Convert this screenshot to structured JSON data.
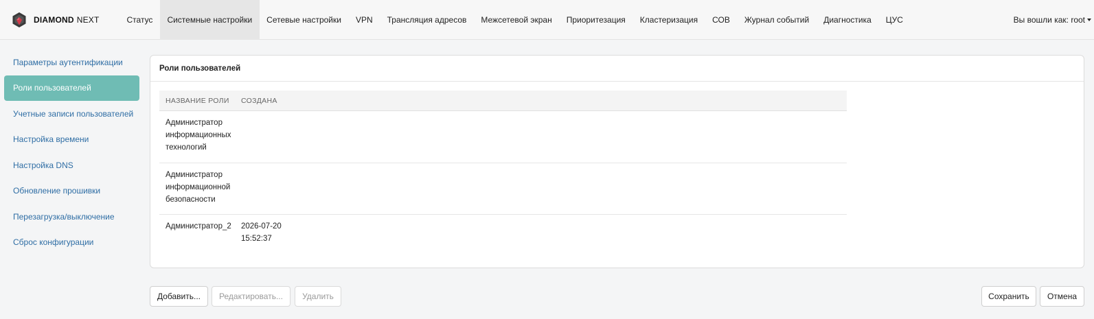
{
  "brand": {
    "name": "DIAMOND",
    "suffix": "NEXT"
  },
  "nav": [
    {
      "label": "Статус",
      "active": false
    },
    {
      "label": "Системные настройки",
      "active": true
    },
    {
      "label": "Сетевые настройки",
      "active": false
    },
    {
      "label": "VPN",
      "active": false
    },
    {
      "label": "Трансляция адресов",
      "active": false
    },
    {
      "label": "Межсетевой экран",
      "active": false
    },
    {
      "label": "Приоритезация",
      "active": false
    },
    {
      "label": "Кластеризация",
      "active": false
    },
    {
      "label": "СОВ",
      "active": false
    },
    {
      "label": "Журнал событий",
      "active": false
    },
    {
      "label": "Диагностика",
      "active": false
    },
    {
      "label": "ЦУС",
      "active": false
    }
  ],
  "user": {
    "label": "Вы вошли как: root"
  },
  "sidebar": [
    {
      "label": "Параметры аутентификации",
      "active": false
    },
    {
      "label": "Роли пользователей",
      "active": true
    },
    {
      "label": "Учетные записи пользователей",
      "active": false
    },
    {
      "label": "Настройка времени",
      "active": false
    },
    {
      "label": "Настройка DNS",
      "active": false
    },
    {
      "label": "Обновление прошивки",
      "active": false
    },
    {
      "label": "Перезагрузка/выключение",
      "active": false
    },
    {
      "label": "Сброс конфигурации",
      "active": false
    }
  ],
  "panel": {
    "title": "Роли пользователей",
    "columns": {
      "name": "Название роли",
      "created": "Создана"
    },
    "rows": [
      {
        "name": "Администратор информационных технологий",
        "created": ""
      },
      {
        "name": "Администратор информационной безопасности",
        "created": ""
      },
      {
        "name": "Администратор_2",
        "created": "2026-07-20 15:52:37"
      }
    ]
  },
  "buttons": {
    "add": "Добавить...",
    "edit": "Редактировать...",
    "delete": "Удалить",
    "save": "Сохранить",
    "cancel": "Отмена"
  },
  "colors": {
    "accent": "#6fbcb4",
    "link": "#2e6da4",
    "logo_dark": "#3a3a3a",
    "logo_red": "#d23a4a"
  }
}
